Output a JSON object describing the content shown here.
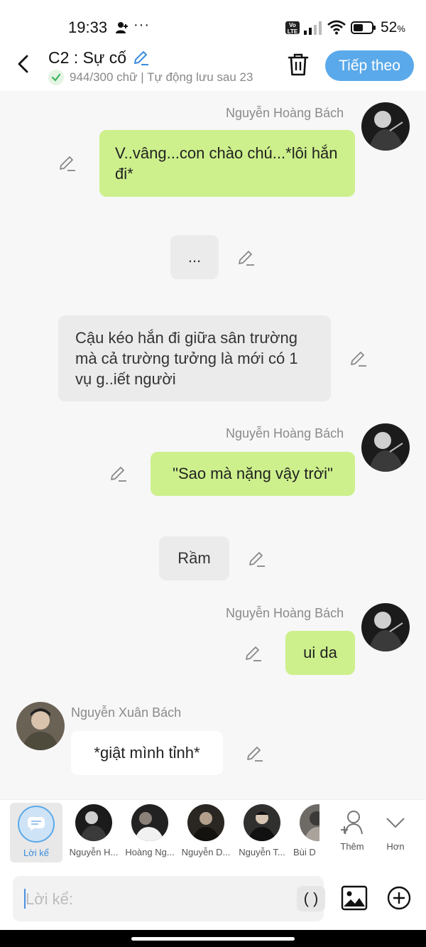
{
  "status_bar": {
    "time": "19:33",
    "dots": "···",
    "volte": "Vo LTE",
    "battery": "52",
    "battery_unit": "%"
  },
  "header": {
    "title": "C2 : Sự cố",
    "subtitle": "944/300 chữ | Tự động lưu sau 23",
    "next_label": "Tiếp theo",
    "accent": "#5aa9ea"
  },
  "messages": [
    {
      "type": "character",
      "name": "Nguyễn Hoàng Bách",
      "text": "V..vâng...con chào chú...*lôi hắn đi*",
      "color": "#cdf08c"
    },
    {
      "type": "narration",
      "text": "..."
    },
    {
      "type": "narration",
      "text": "Cậu kéo hắn đi giữa sân trường mà cả trường tưởng là mới có 1 vụ g..iết người"
    },
    {
      "type": "character",
      "name": "Nguyễn Hoàng Bách",
      "text": "\"Sao mà nặng vậy trời\"",
      "color": "#cdf08c"
    },
    {
      "type": "narration",
      "text": "Rầm"
    },
    {
      "type": "character",
      "name": "Nguyễn Hoàng Bách",
      "text": "ui da",
      "color": "#cdf08c"
    },
    {
      "type": "character",
      "name": "Nguyễn Xuân Bách",
      "text": "*giật mình tỉnh*",
      "color": "#ffffff"
    }
  ],
  "character_bar": {
    "narrator_label": "Lời kể",
    "characters": [
      "Nguyễn H...",
      "Hoàng Ng...",
      "Nguyễn D...",
      "Nguyễn T...",
      "Bùi D"
    ],
    "more_label": "Thêm",
    "expand_label": "Hơn"
  },
  "input": {
    "placeholder": "Lời kể:",
    "paren_label": "( )"
  }
}
